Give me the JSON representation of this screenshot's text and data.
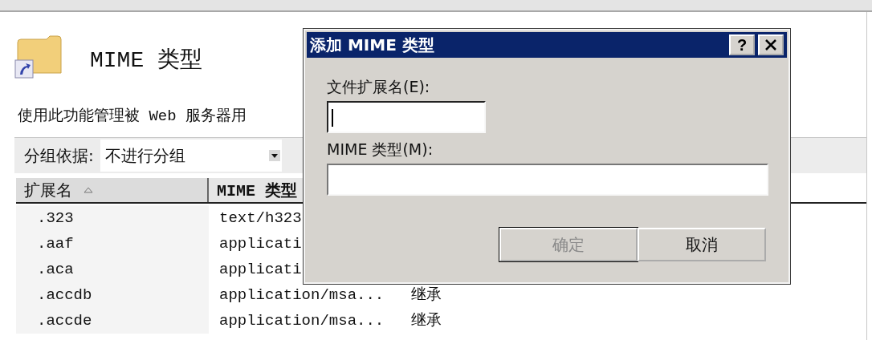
{
  "page": {
    "title": "MIME 类型",
    "description": "使用此功能管理被 Web 服务器用"
  },
  "group_by": {
    "label": "分组依据:",
    "value": "不进行分组"
  },
  "table": {
    "columns": [
      {
        "label": "扩展名",
        "sorted": true
      },
      {
        "label": "MIME 类型"
      }
    ],
    "rows": [
      {
        "extension": ".323",
        "mime_type": "text/h323"
      },
      {
        "extension": ".aaf",
        "mime_type": "applicati"
      },
      {
        "extension": ".aca",
        "mime_type": "applicati"
      },
      {
        "extension": ".accdb",
        "mime_type": "application/msa...",
        "column_3": "继承"
      },
      {
        "extension": ".accde",
        "mime_type": "application/msa...",
        "column_3": "继承"
      }
    ]
  },
  "dialog": {
    "title": "添加 MIME 类型",
    "help": "?",
    "fields": [
      {
        "label": "文件扩展名(E):",
        "focused": true,
        "wide": false
      },
      {
        "label": "MIME 类型(M):",
        "focused": false,
        "wide": true
      }
    ],
    "buttons": [
      {
        "label": "确定",
        "disabled": true
      },
      {
        "label": "取消",
        "disabled": false
      }
    ]
  }
}
